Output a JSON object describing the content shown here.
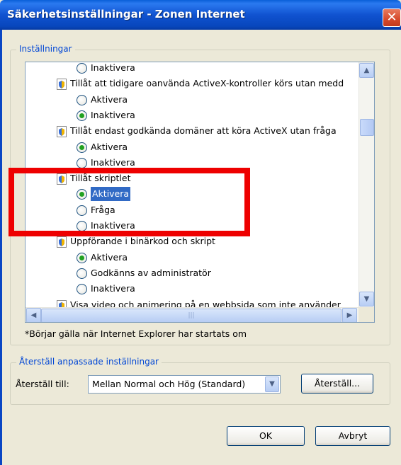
{
  "window": {
    "title": "Säkerhetsinställningar - Zonen Internet"
  },
  "settings_group": {
    "title": "Inställningar"
  },
  "list": {
    "rows": [
      {
        "kind": "option",
        "label": "Inaktivera",
        "checked": false
      },
      {
        "kind": "heading",
        "label": "Tillåt att tidigare oanvända ActiveX-kontroller körs utan medd"
      },
      {
        "kind": "option",
        "label": "Aktivera",
        "checked": false
      },
      {
        "kind": "option",
        "label": "Inaktivera",
        "checked": true
      },
      {
        "kind": "heading",
        "label": "Tillåt endast godkända domäner att köra ActiveX utan fråga"
      },
      {
        "kind": "option",
        "label": "Aktivera",
        "checked": true
      },
      {
        "kind": "option",
        "label": "Inaktivera",
        "checked": false
      },
      {
        "kind": "heading",
        "label": "Tillåt skriptlet"
      },
      {
        "kind": "option",
        "label": "Aktivera",
        "checked": true,
        "selected": true
      },
      {
        "kind": "option",
        "label": "Fråga",
        "checked": false
      },
      {
        "kind": "option",
        "label": "Inaktivera",
        "checked": false
      },
      {
        "kind": "heading",
        "label": "Uppförande i binärkod och skript"
      },
      {
        "kind": "option",
        "label": "Aktivera",
        "checked": true
      },
      {
        "kind": "option",
        "label": "Godkänns av administratör",
        "checked": false
      },
      {
        "kind": "option",
        "label": "Inaktivera",
        "checked": false
      },
      {
        "kind": "heading",
        "label": "Visa video och animering på en webbsida som inte använder"
      }
    ]
  },
  "footnote": "*Börjar gälla när Internet Explorer har startats om",
  "reset_group": {
    "title": "Återställ anpassade inställningar",
    "reset_to_label": "Återställ till:",
    "combo_value": "Mellan Normal och Hög (Standard)",
    "reset_button": "Återställ..."
  },
  "buttons": {
    "ok": "OK",
    "cancel": "Avbryt"
  },
  "colors": {
    "title_bar": "#0a5fd8",
    "highlight": "#ee0000",
    "selection": "#316ac5"
  }
}
